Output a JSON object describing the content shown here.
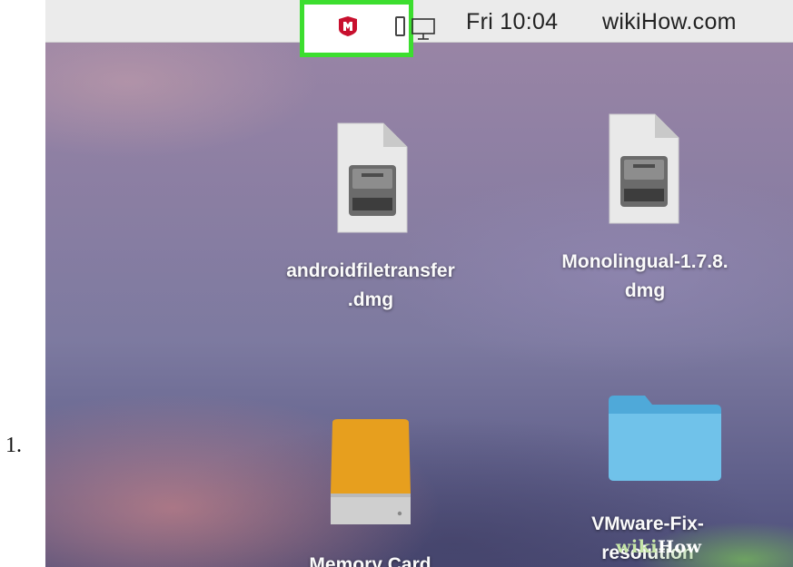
{
  "step": {
    "number": "1."
  },
  "menubar": {
    "clock": "Fri 10:04",
    "user": "wikiHow.com",
    "icons": [
      "mcafee-icon",
      "battery-icon",
      "display-icon"
    ],
    "highlight_color": "#3cde2f",
    "mcafee_color": "#c8102e"
  },
  "desktop": {
    "files": [
      {
        "name_line1": "androidfiletransfer",
        "name_line2": ".dmg",
        "icon": "dmg-file-icon"
      },
      {
        "name_line1": "Monolingual-1.7.8.",
        "name_line2": "dmg",
        "icon": "dmg-file-icon"
      },
      {
        "name_line1": "Memory Card",
        "icon": "external-drive-icon"
      },
      {
        "name_line1": "VMware-Fix-",
        "name_line2": "resolution",
        "icon": "folder-icon"
      }
    ]
  },
  "watermark": {
    "part1": "wiki",
    "part2": "How"
  }
}
